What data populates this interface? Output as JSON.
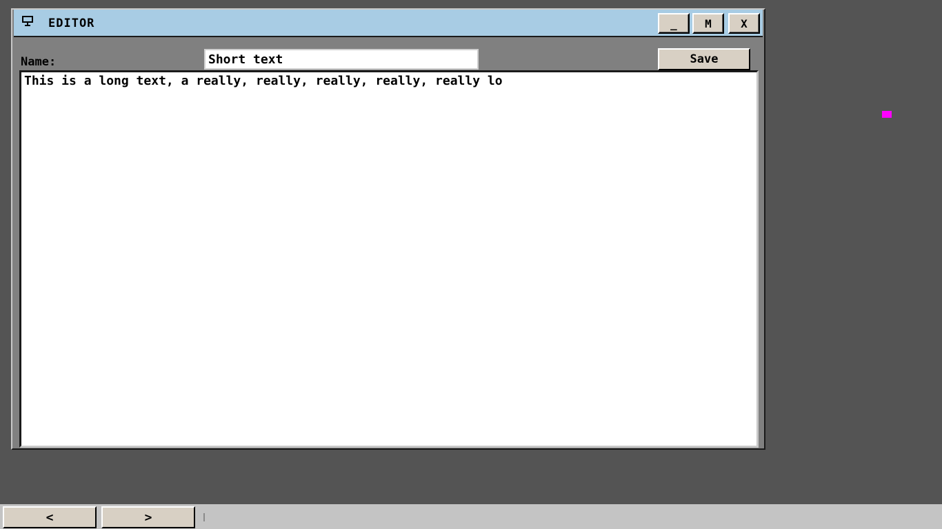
{
  "window": {
    "title": "EDITOR",
    "icon": "computer-icon",
    "controls": {
      "minimize_label": "_",
      "maximize_label": "M",
      "close_label": "X"
    }
  },
  "form": {
    "name_label": "Name:",
    "name_value": "Short text",
    "save_label": "Save",
    "content_value": "This is a long text, a really, really, really, really, really lo"
  },
  "taskbar": {
    "prev_label": "<",
    "next_label": ">"
  },
  "colors": {
    "desktop": "#545454",
    "titlebar": "#a8cce4",
    "window_body": "#808080",
    "button_face": "#d8d0c4",
    "taskbar": "#c4c4c4",
    "cursor_marker": "#ff00ff"
  }
}
